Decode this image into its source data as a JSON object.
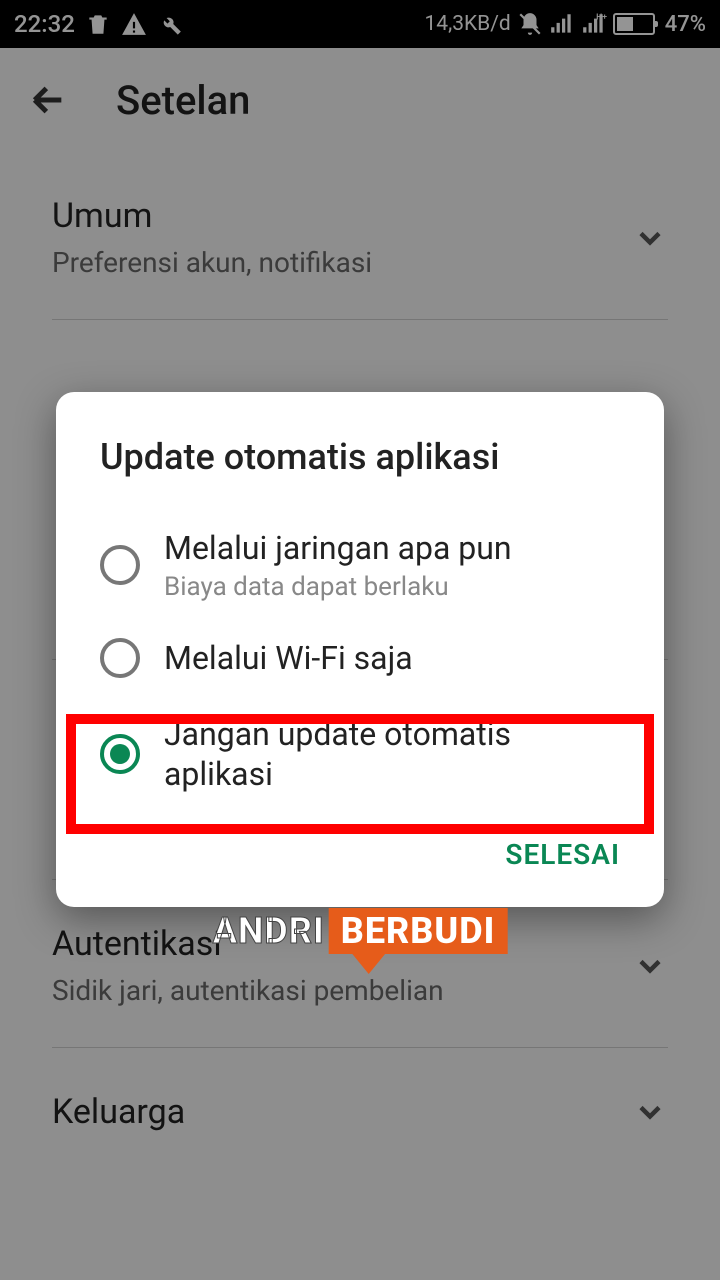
{
  "status": {
    "time": "22:32",
    "dataRate": "14,3KB/d",
    "battery": "47%"
  },
  "toolbar": {
    "title": "Setelan"
  },
  "settings": {
    "umum": {
      "title": "Umum",
      "sub": "Preferensi akun, notifikasi"
    },
    "hidden1": {
      "title": " ",
      "sub": " "
    },
    "hidden2": {
      "title": " ",
      "sub": " "
    },
    "autentikasi": {
      "title": "Autentikasi",
      "sub": "Sidik jari, autentikasi pembelian"
    },
    "keluarga": {
      "title": "Keluarga"
    }
  },
  "dialog": {
    "title": "Update otomatis aplikasi",
    "options": [
      {
        "label": "Melalui jaringan apa pun",
        "sub": "Biaya data dapat berlaku"
      },
      {
        "label": "Melalui Wi-Fi saja"
      },
      {
        "label": "Jangan update otomatis aplikasi"
      }
    ],
    "done": "SELESAI"
  },
  "watermark": {
    "left": "ANDRI",
    "right": "BERBUDI"
  }
}
